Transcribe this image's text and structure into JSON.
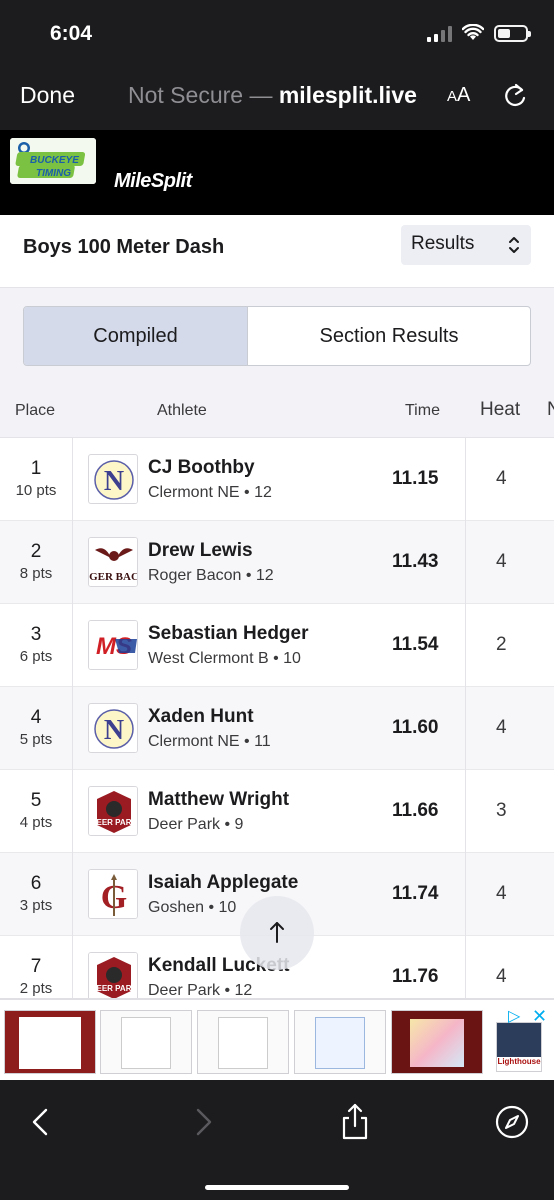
{
  "status_bar": {
    "time": "6:04"
  },
  "browser": {
    "done_label": "Done",
    "url_prefix": "Not Secure — ",
    "url_host": "milesplit.live",
    "aa_small": "A",
    "aa_large": "A"
  },
  "site": {
    "logo_brand": "BUCKEYE TIMING",
    "brand": "MileSplit"
  },
  "event": {
    "title": "Boys 100 Meter Dash",
    "view_select": "Results"
  },
  "tabs": {
    "compiled": "Compiled",
    "section_results": "Section Results"
  },
  "table": {
    "headers": {
      "place": "Place",
      "athlete": "Athlete",
      "time": "Time",
      "heat": "Heat",
      "more": "N"
    },
    "rows": [
      {
        "place": "1",
        "pts": "10 pts",
        "name": "CJ Boothby",
        "team": "Clermont NE • 12",
        "time": "11.15",
        "heat": "4",
        "logo": "clermont-ne"
      },
      {
        "place": "2",
        "pts": "8 pts",
        "name": "Drew Lewis",
        "team": "Roger Bacon • 12",
        "time": "11.43",
        "heat": "4",
        "logo": "roger-bacon"
      },
      {
        "place": "3",
        "pts": "6 pts",
        "name": "Sebastian Hedger",
        "team": "West Clermont B • 10",
        "time": "11.54",
        "heat": "2",
        "logo": "milesplit"
      },
      {
        "place": "4",
        "pts": "5 pts",
        "name": "Xaden Hunt",
        "team": "Clermont NE • 11",
        "time": "11.60",
        "heat": "4",
        "logo": "clermont-ne"
      },
      {
        "place": "5",
        "pts": "4 pts",
        "name": "Matthew Wright",
        "team": "Deer Park • 9",
        "time": "11.66",
        "heat": "3",
        "logo": "deer-park"
      },
      {
        "place": "6",
        "pts": "3 pts",
        "name": "Isaiah Applegate",
        "team": "Goshen • 10",
        "time": "11.74",
        "heat": "4",
        "logo": "goshen"
      },
      {
        "place": "7",
        "pts": "2 pts",
        "name": "Kendall Luckett",
        "team": "Deer Park • 12",
        "time": "11.76",
        "heat": "4",
        "logo": "deer-park"
      }
    ]
  },
  "logo_text": {
    "clermont": "N",
    "roger": "OGER BACO",
    "ms": "MS",
    "deer": "DEER PARK",
    "goshen": "G"
  },
  "ad": {
    "badge": "▷",
    "close": "✕",
    "brand": "Lighthouse"
  },
  "colors": {
    "accent": "#d4daea",
    "chrome": "#1c1c1e",
    "ad_accent": "#00aeef"
  }
}
